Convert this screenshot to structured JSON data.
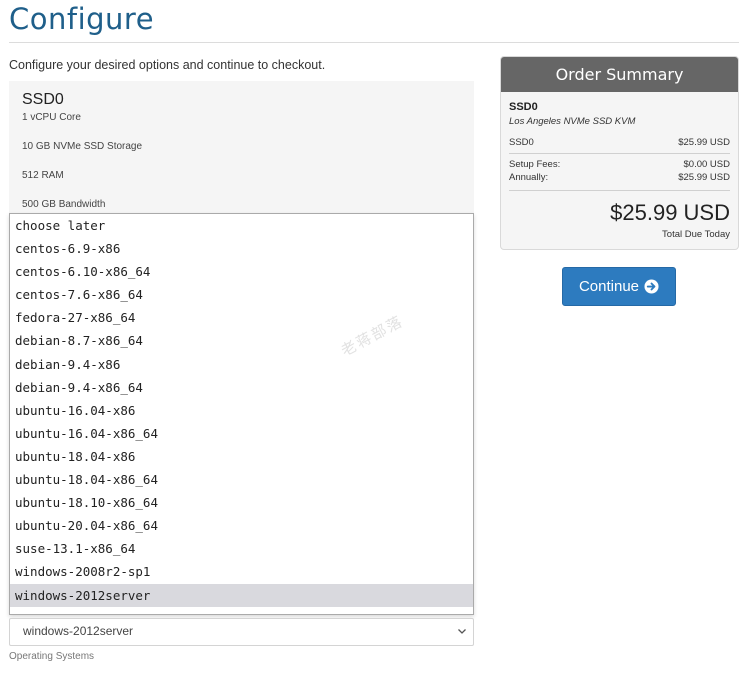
{
  "page": {
    "title": "Configure",
    "intro": "Configure your desired options and continue to checkout."
  },
  "product": {
    "name": "SSD0",
    "specs": [
      "1 vCPU Core",
      "10 GB NVMe SSD Storage",
      "512 RAM",
      "500 GB Bandwidth"
    ]
  },
  "os_select": {
    "options": [
      "choose later",
      "centos-6.9-x86",
      "centos-6.10-x86_64",
      "centos-7.6-x86_64",
      "fedora-27-x86_64",
      "debian-8.7-x86_64",
      "debian-9.4-x86",
      "debian-9.4-x86_64",
      "ubuntu-16.04-x86",
      "ubuntu-16.04-x86_64",
      "ubuntu-18.04-x86",
      "ubuntu-18.04-x86_64",
      "ubuntu-18.10-x86_64",
      "ubuntu-20.04-x86_64",
      "suse-13.1-x86_64",
      "windows-2008r2-sp1",
      "windows-2012server"
    ],
    "selected": "windows-2012server",
    "help": "Operating Systems"
  },
  "watermark": "老蒋部落",
  "summary": {
    "header": "Order Summary",
    "product": "SSD0",
    "group": "Los Angeles NVMe SSD KVM",
    "line_item": {
      "label": "SSD0",
      "amount": "$25.99 USD"
    },
    "setup": {
      "label": "Setup Fees:",
      "amount": "$0.00 USD"
    },
    "cycle": {
      "label": "Annually:",
      "amount": "$25.99 USD"
    },
    "total": "$25.99 USD",
    "total_label": "Total Due Today"
  },
  "actions": {
    "continue": "Continue"
  },
  "colors": {
    "title": "#1f5f8a",
    "button": "#2d7bbf",
    "summary_header": "#666666"
  },
  "icons": {
    "continue": "arrow-circle-right-icon",
    "select": "chevron-down-icon"
  }
}
